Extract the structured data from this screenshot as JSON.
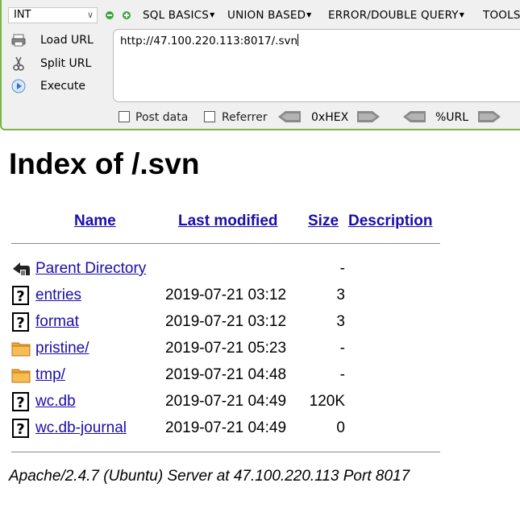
{
  "hackbar": {
    "type_value": "INT",
    "menus": [
      {
        "label": "SQL BASICS",
        "has_arrow": true
      },
      {
        "label": "UNION BASED",
        "has_arrow": true
      },
      {
        "label": "ERROR/DOUBLE QUERY",
        "has_arrow": true
      },
      {
        "label": "TOOLS",
        "has_arrow": false
      }
    ],
    "load_url_label": "Load URL",
    "split_url_label": "Split URL",
    "execute_label": "Execute",
    "url_value": "http://47.100.220.113:8017/.svn",
    "post_data_label": "Post data",
    "referrer_label": "Referrer",
    "hex_label": "0xHEX",
    "url_enc_label": "%URL"
  },
  "listing": {
    "title": "Index of /.svn",
    "headers": {
      "name": "Name",
      "last_modified": "Last modified",
      "size": "Size",
      "description": "Description"
    },
    "rows": [
      {
        "icon": "back-icon",
        "name": "Parent Directory",
        "date": "",
        "size": "-"
      },
      {
        "icon": "unknown-file-icon",
        "name": "entries",
        "date": "2019-07-21 03:12",
        "size": "3"
      },
      {
        "icon": "unknown-file-icon",
        "name": "format",
        "date": "2019-07-21 03:12",
        "size": "3"
      },
      {
        "icon": "folder-icon",
        "name": "pristine/",
        "date": "2019-07-21 05:23",
        "size": "-"
      },
      {
        "icon": "folder-icon",
        "name": "tmp/",
        "date": "2019-07-21 04:48",
        "size": "-"
      },
      {
        "icon": "unknown-file-icon",
        "name": "wc.db",
        "date": "2019-07-21 04:49",
        "size": "120K"
      },
      {
        "icon": "unknown-file-icon",
        "name": "wc.db-journal",
        "date": "2019-07-21 04:49",
        "size": "0"
      }
    ],
    "footer": "Apache/2.4.7 (Ubuntu) Server at 47.100.220.113 Port 8017"
  },
  "colors": {
    "accent_green": "#79b34a",
    "link": "#1a0dab",
    "folder": "#f0a830"
  }
}
